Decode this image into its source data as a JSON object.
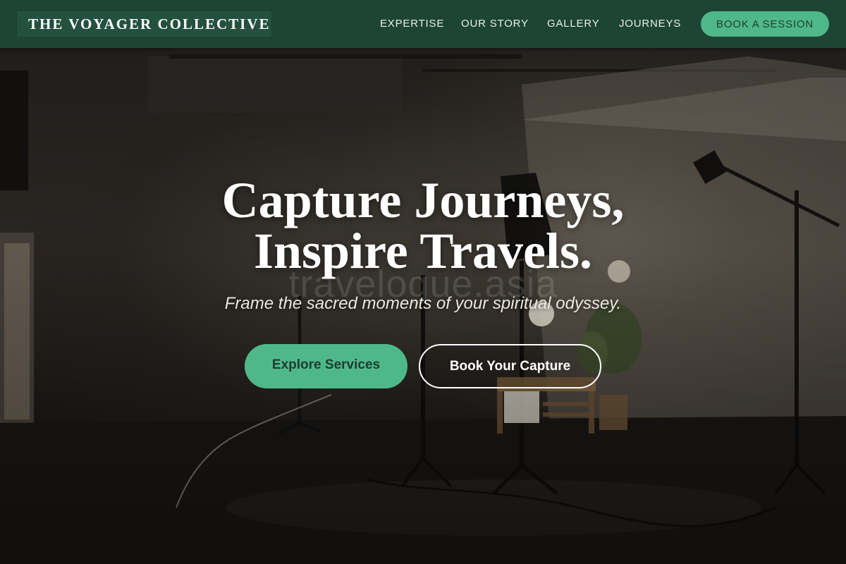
{
  "brand": {
    "name": "THE VOYAGER COLLECTIVE"
  },
  "nav": {
    "links": [
      {
        "label": "EXPERTISE"
      },
      {
        "label": "OUR STORY"
      },
      {
        "label": "GALLERY"
      },
      {
        "label": "JOURNEYS"
      }
    ],
    "cta_label": "BOOK A SESSION"
  },
  "hero": {
    "headline_line1": "Capture Journeys,",
    "headline_line2": "Inspire Travels.",
    "subheadline": "Frame the sacred moments of your spiritual odyssey.",
    "watermark": "travelogue.asia",
    "primary_button": "Explore Services",
    "secondary_button": "Book Your Capture"
  },
  "colors": {
    "nav_background": "#1d4435",
    "brand_box": "#23503f",
    "accent_green": "#4fb88b",
    "text_white": "#ffffff"
  }
}
